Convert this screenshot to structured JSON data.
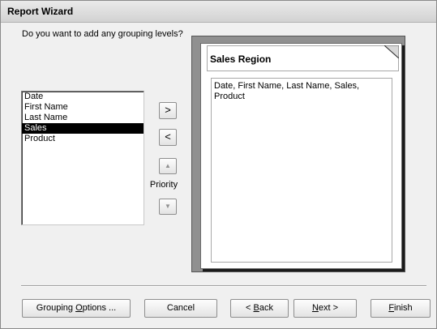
{
  "window": {
    "title": "Report Wizard"
  },
  "question": "Do you want to add any grouping levels?",
  "fields": [
    {
      "label": "Date",
      "selected": false
    },
    {
      "label": "First Name",
      "selected": false
    },
    {
      "label": "Last Name",
      "selected": false
    },
    {
      "label": "Sales",
      "selected": true
    },
    {
      "label": "Product",
      "selected": false
    }
  ],
  "buttons": {
    "add": ">",
    "remove": "<",
    "priority_up": "▲",
    "priority_down": "▼",
    "priority_label": "Priority"
  },
  "preview": {
    "group_label": "Sales Region",
    "detail_text": "Date, First Name, Last Name, Sales, Product"
  },
  "footer": {
    "grouping_options": {
      "pre": "Grouping ",
      "key": "O",
      "post": "ptions ..."
    },
    "cancel": {
      "pre": "",
      "key": "",
      "post": "Cancel"
    },
    "back": {
      "pre": "< ",
      "key": "B",
      "post": "ack"
    },
    "next": {
      "pre": "",
      "key": "N",
      "post": "ext >"
    },
    "finish": {
      "pre": "",
      "key": "F",
      "post": "inish"
    }
  }
}
